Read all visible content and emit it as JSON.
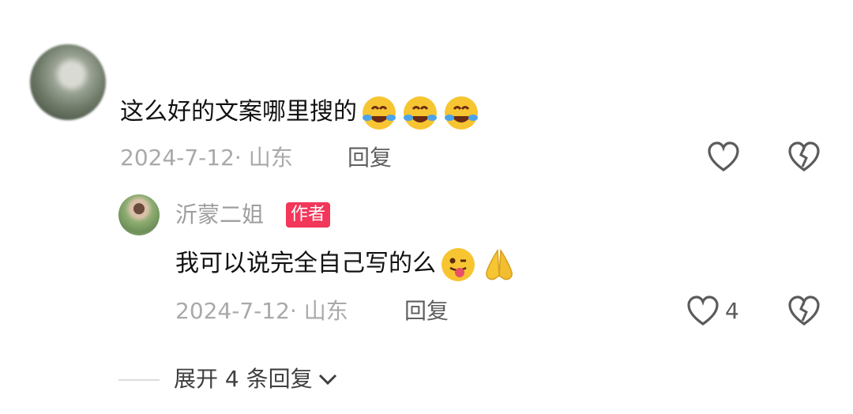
{
  "comment": {
    "text": "这么好的文案哪里搜的",
    "emojis": [
      "rofl-emoji",
      "rofl-emoji",
      "rofl-emoji"
    ],
    "meta": "2024-7-12· 山东",
    "reply_label": "回复"
  },
  "reply": {
    "author": "沂蒙二姐",
    "badge": "作者",
    "text": "我可以说完全自己写的么",
    "emojis": [
      "winking-tongue-emoji",
      "praying-hands-emoji"
    ],
    "meta": "2024-7-12· 山东",
    "reply_label": "回复",
    "like_count": "4"
  },
  "expand": {
    "label": "展开 4 条回复"
  },
  "colors": {
    "badge": "#f2375a",
    "meta": "#a9a9a9",
    "text": "#111111"
  },
  "icons": [
    "heart-outline-icon",
    "broken-heart-icon",
    "chevron-down-icon"
  ]
}
